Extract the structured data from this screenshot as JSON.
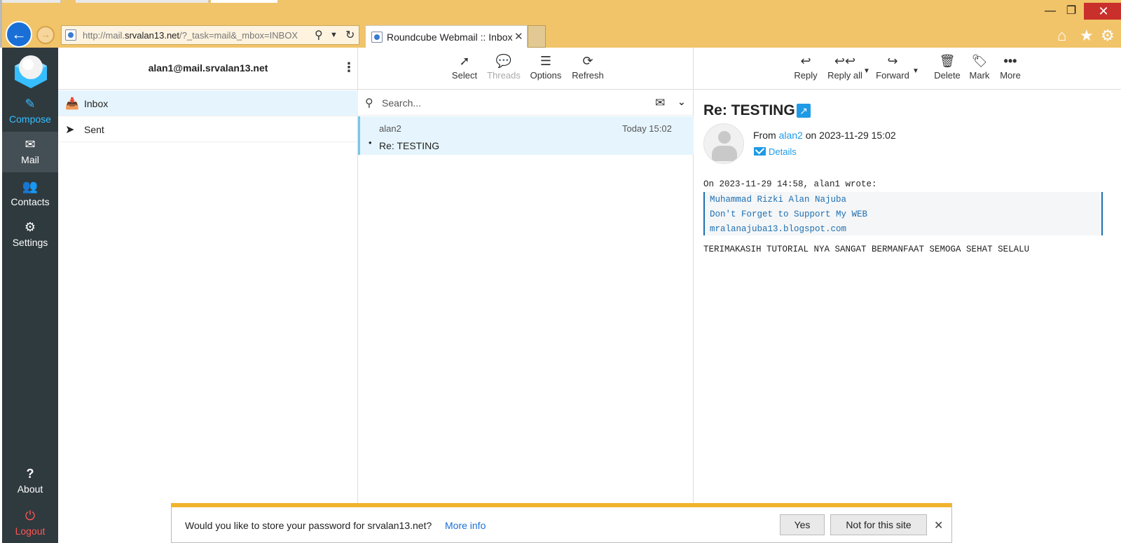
{
  "browser": {
    "url_prefix": "http://mail.",
    "url_domain": "srvalan13.net",
    "url_rest": "/?_task=mail&_mbox=INBOX",
    "tab_title": "Roundcube Webmail :: Inbox",
    "tab_close": "✕",
    "window_controls": {
      "minimize": "—",
      "restore": "❐",
      "close": "✕"
    }
  },
  "nav": {
    "items": [
      {
        "label": "Compose",
        "icon": "compose-icon"
      },
      {
        "label": "Mail",
        "icon": "mail-icon"
      },
      {
        "label": "Contacts",
        "icon": "contacts-icon"
      },
      {
        "label": "Settings",
        "icon": "gear-icon"
      },
      {
        "label": "About",
        "icon": "question-icon"
      },
      {
        "label": "Logout",
        "icon": "power-icon"
      }
    ]
  },
  "folders": {
    "account": "alan1@mail.srvalan13.net",
    "items": [
      {
        "label": "Inbox",
        "icon": "inbox-icon"
      },
      {
        "label": "Sent",
        "icon": "paper-plane-icon"
      }
    ]
  },
  "list_toolbar": {
    "select": "Select",
    "threads": "Threads",
    "options": "Options",
    "refresh": "Refresh"
  },
  "search": {
    "placeholder": "Search..."
  },
  "messages": [
    {
      "from": "alan2",
      "date": "Today 15:02",
      "subject": "Re: TESTING"
    }
  ],
  "preview_toolbar": {
    "reply": "Reply",
    "reply_all": "Reply all",
    "forward": "Forward",
    "delete": "Delete",
    "mark": "Mark",
    "more": "More"
  },
  "message": {
    "subject": "Re: TESTING",
    "from_prefix": "From",
    "from_name": "alan2",
    "date_text": "on 2023-11-29 15:02",
    "details": "Details",
    "quote_intro": "On 2023-11-29 14:58, alan1 wrote:",
    "quote_lines": [
      "Muhammad Rizki Alan Najuba",
      "Don't Forget to Support My WEB",
      "mralanajuba13.blogspot.com"
    ],
    "body": "TERIMAKASIH TUTORIAL NYA SANGAT BERMANFAAT SEMOGA SEHAT SELALU"
  },
  "password_prompt": {
    "text": "Would you like to store your password for srvalan13.net?",
    "more_info": "More info",
    "yes": "Yes",
    "no": "Not for this site",
    "close": "✕"
  },
  "colors": {
    "chrome": "#f1c46a",
    "sidebar": "#2f3a3f",
    "accent": "#1f9ae6",
    "selection": "#e6f5fd",
    "logout": "#ff5552"
  }
}
